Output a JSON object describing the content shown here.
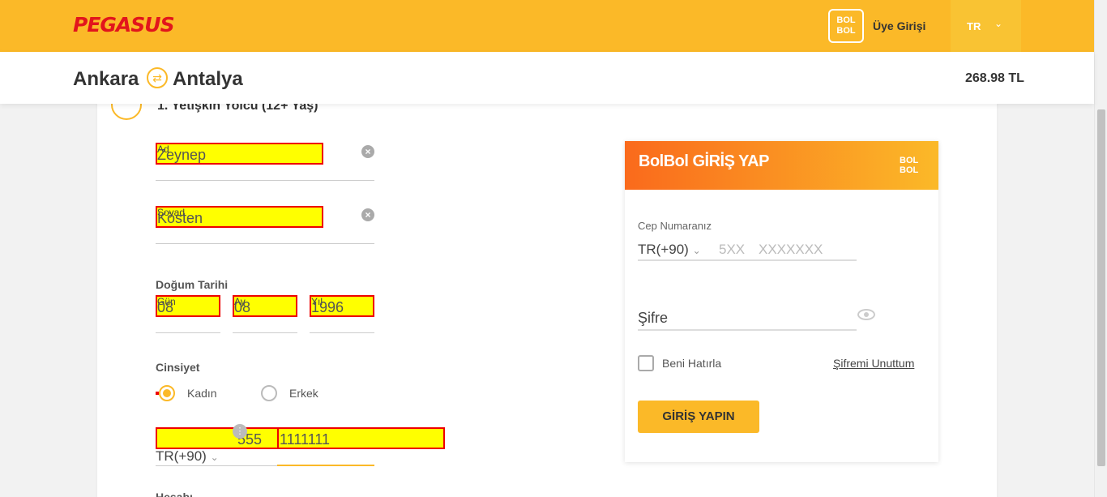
{
  "header": {
    "logo": "PEGASUS",
    "bolbol_badge": "BOL BOL",
    "member_login": "Üye Girişi",
    "language": "TR"
  },
  "route": {
    "from": "Ankara",
    "to": "Antalya",
    "price": "268.98 TL"
  },
  "passenger": {
    "title": "1. Yetişkin Yolcu (12+ Yaş)",
    "first_name": {
      "label": "Ad",
      "value": "Zeynep"
    },
    "last_name": {
      "label": "Soyad",
      "value": "Kösten"
    },
    "birth_date": {
      "label": "Doğum Tarihi",
      "day": {
        "label": "Gün",
        "value": "08"
      },
      "month": {
        "label": "Ay",
        "value": "08"
      },
      "year": {
        "label": "Yıl",
        "value": "1996"
      }
    },
    "gender": {
      "label": "Cinsiyet",
      "options": [
        "Kadın",
        "Erkek"
      ],
      "selected": "Kadın"
    },
    "phone": {
      "country": "TR(+90)",
      "area": "555",
      "number": "1111111"
    },
    "next_label": "Hesabı"
  },
  "bolbol": {
    "title": "BolBol GİRİŞ YAP",
    "logo": "BOL BOL",
    "phone_label": "Cep Numaranız",
    "country": "TR(+90)",
    "placeholder_area": "5XX",
    "placeholder_number": "XXXXXXX",
    "password_label": "Şifre",
    "remember": "Beni Hatırla",
    "forgot": "Şifremi Unuttum",
    "login_button": "GİRİŞ YAPIN"
  }
}
